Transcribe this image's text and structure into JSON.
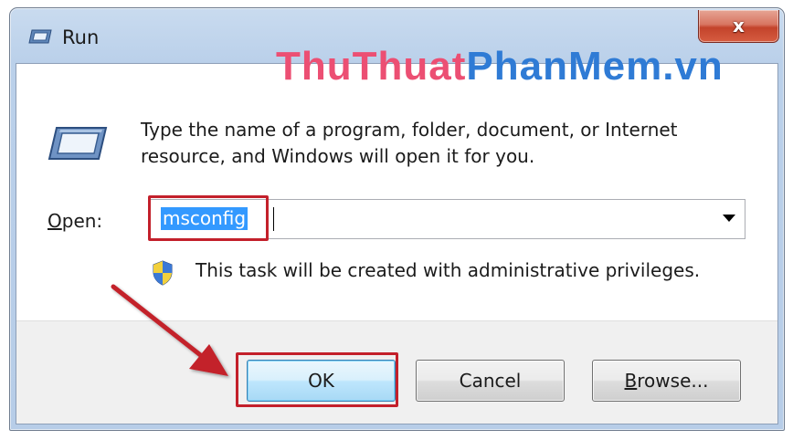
{
  "window": {
    "title": "Run",
    "close_label": "x"
  },
  "watermark": {
    "part1": "ThuThuat",
    "part2": "PhanMem.vn"
  },
  "dialog": {
    "description_line1": "Type the name of a program, folder, document, or Internet",
    "description_line2": "resource, and Windows will open it for you.",
    "open_label_underlined": "O",
    "open_label_rest": "pen:",
    "open_value": "msconfig",
    "admin_note": "This task will be created with administrative privileges."
  },
  "buttons": {
    "ok_label": "OK",
    "cancel_label": "Cancel",
    "browse_underlined": "B",
    "browse_rest": "rowse..."
  },
  "icons": {
    "title": "run-icon",
    "main": "run-icon",
    "shield": "uac-shield-icon",
    "dropdown": "chevron-down-icon"
  },
  "colors": {
    "highlight": "#c3202b",
    "selection": "#3399ff",
    "watermark_pink": "#ec4f73",
    "watermark_blue": "#2f7bd5"
  }
}
